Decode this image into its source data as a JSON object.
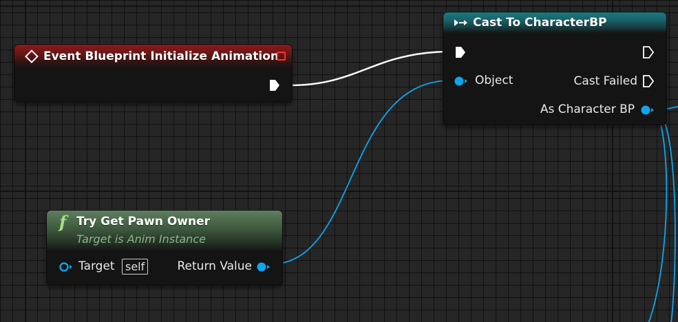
{
  "colors": {
    "graph_background": "#262626",
    "exec_wire": "#ffffff",
    "object_wire": "#0ea5ee",
    "event_header": "#8e1a1c",
    "cast_header": "#1a7a82",
    "function_header": "#5f7d5f"
  },
  "event_node": {
    "title": "Event Blueprint Initialize Animation",
    "icon": "event-diamond-icon"
  },
  "cast_node": {
    "title": "Cast To CharacterBP",
    "icon": "cast-arrow-icon",
    "object_pin": "Object",
    "cast_failed_pin": "Cast Failed",
    "as_character_pin": "As Character BP"
  },
  "function_node": {
    "icon": "function-f-icon",
    "title": "Try Get Pawn Owner",
    "subtitle": "Target is Anim Instance",
    "target_pin": "Target",
    "target_default": "self",
    "return_pin": "Return Value"
  }
}
